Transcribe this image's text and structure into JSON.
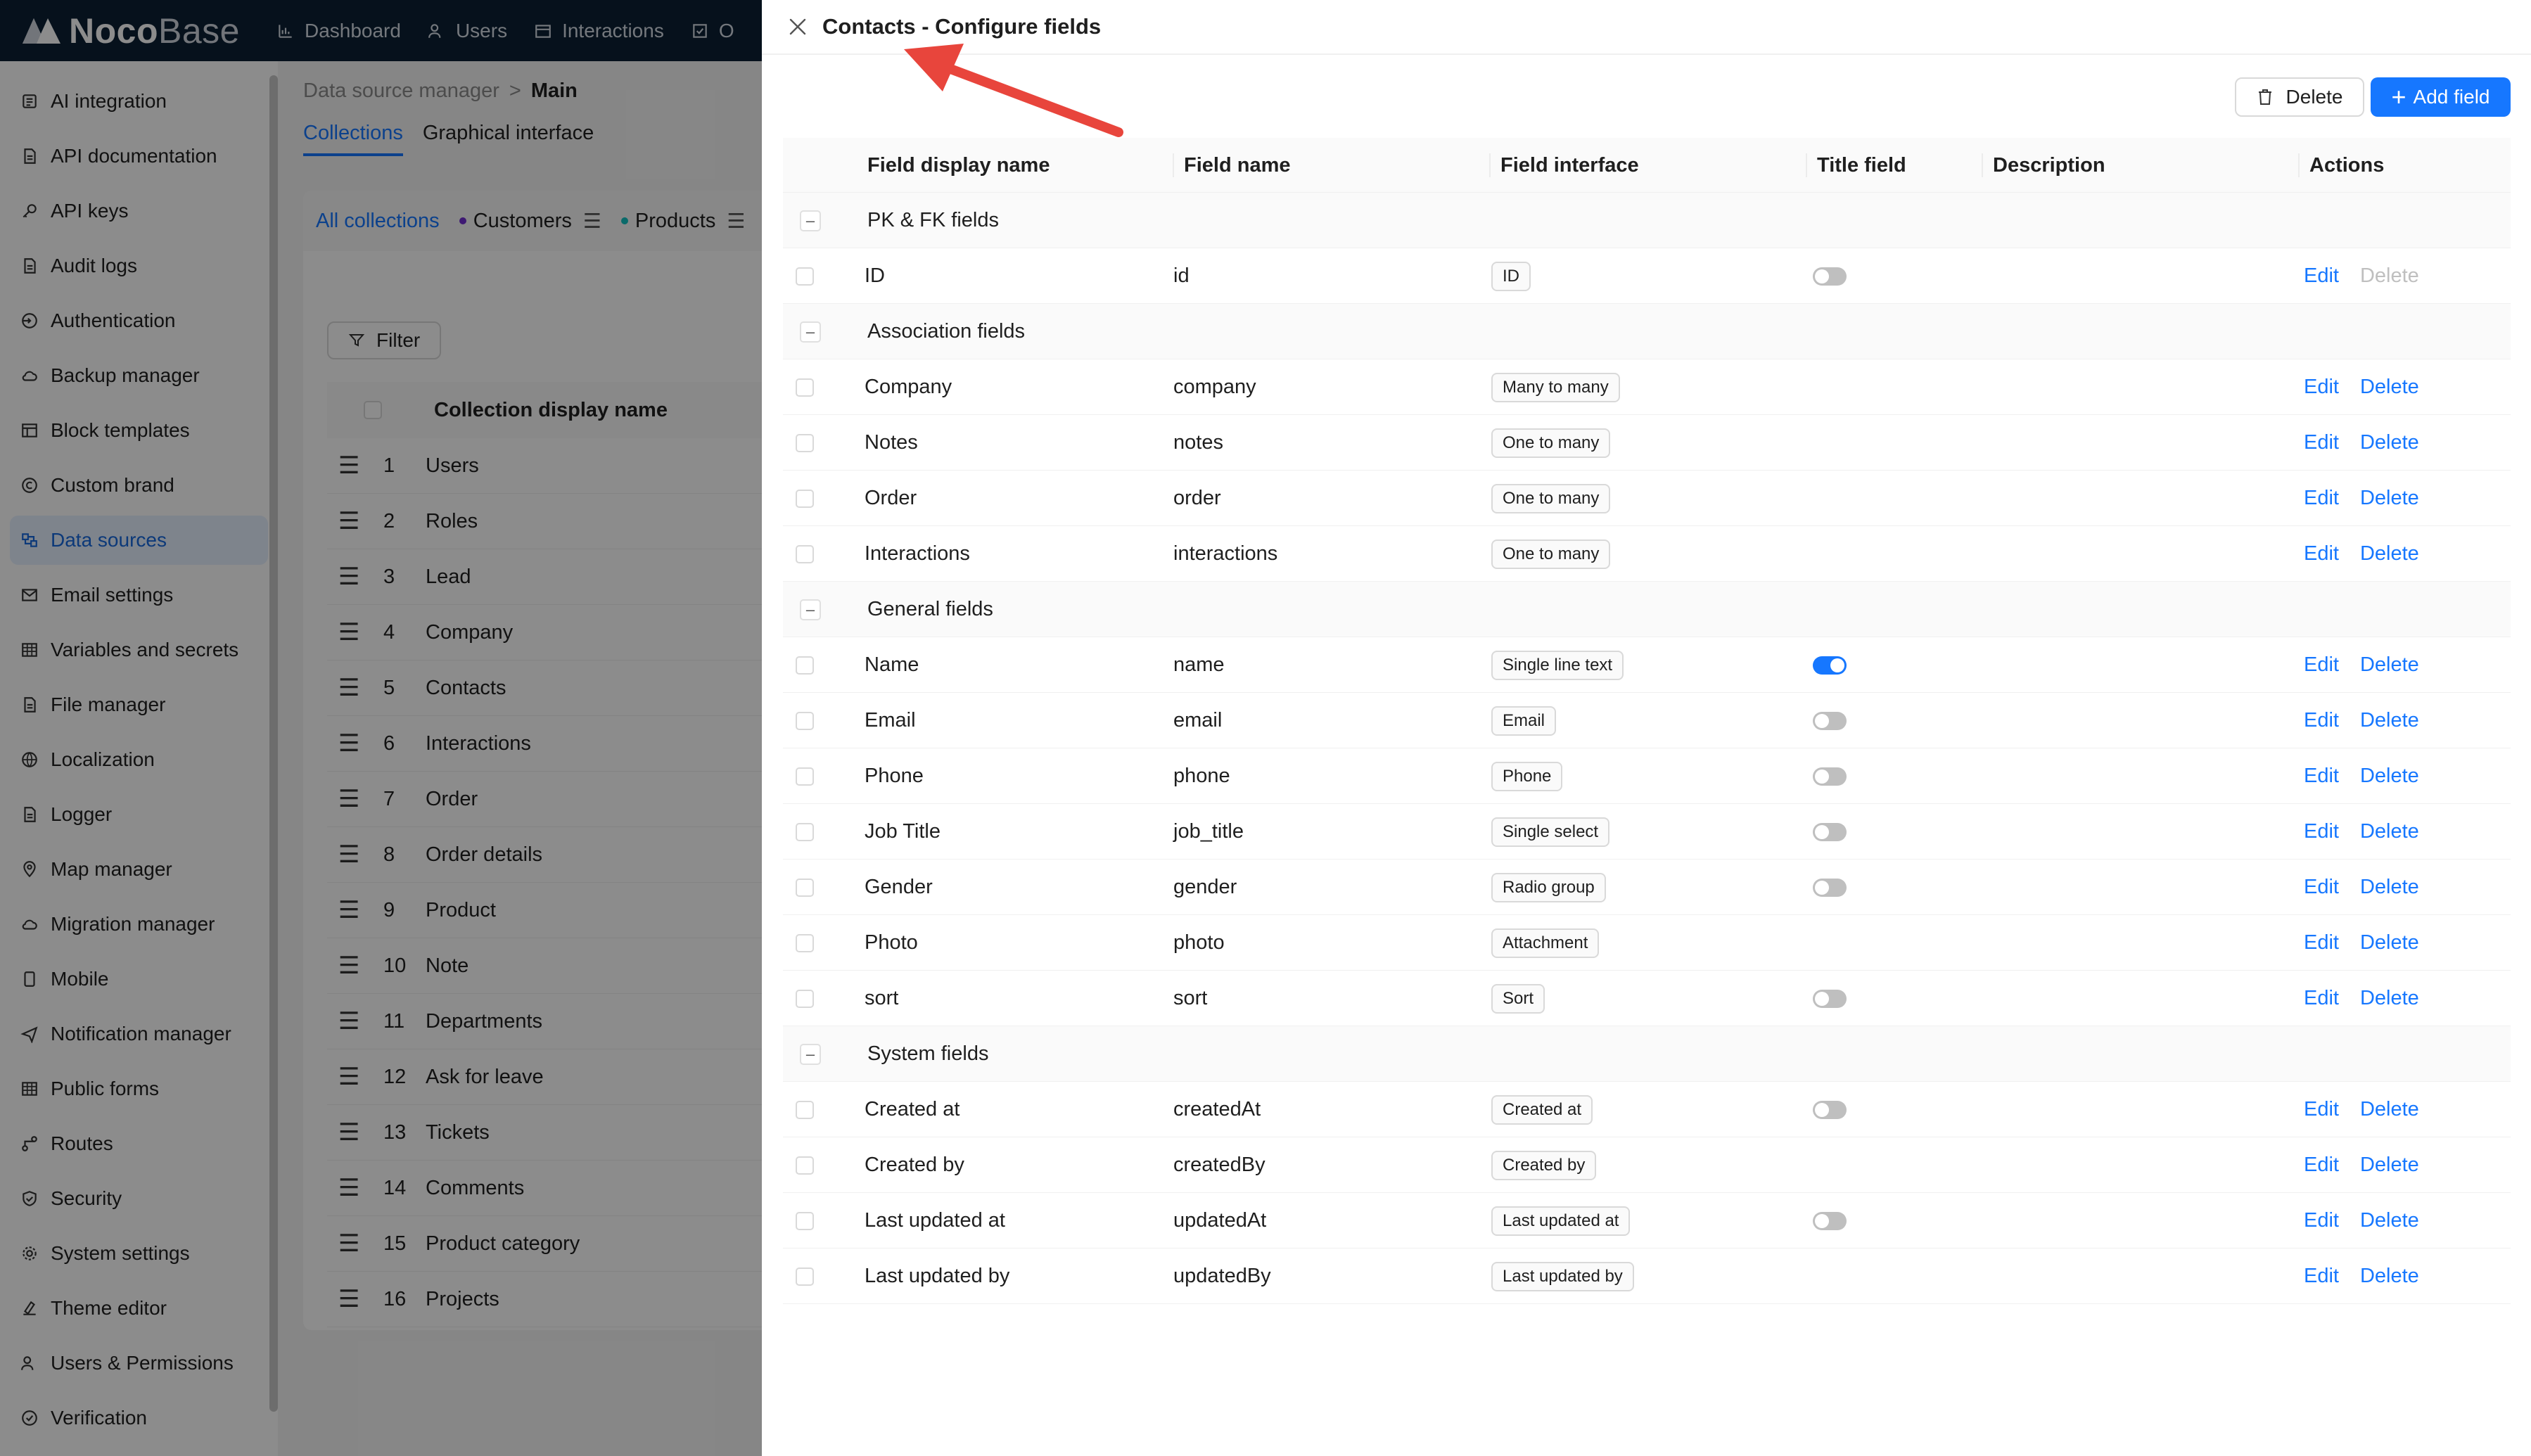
{
  "brand": {
    "name_bold": "Noco",
    "name_light": "Base"
  },
  "topnav": [
    {
      "label": "Dashboard",
      "icon": "chart-icon"
    },
    {
      "label": "Users",
      "icon": "users-icon"
    },
    {
      "label": "Interactions",
      "icon": "calendar-icon"
    },
    {
      "label": "O",
      "icon": "checkbox-icon"
    }
  ],
  "sidebar": {
    "items": [
      {
        "label": "AI integration",
        "icon": "ai-icon",
        "active": false
      },
      {
        "label": "API documentation",
        "icon": "file-icon",
        "active": false
      },
      {
        "label": "API keys",
        "icon": "key-icon",
        "active": false
      },
      {
        "label": "Audit logs",
        "icon": "file-icon",
        "active": false
      },
      {
        "label": "Authentication",
        "icon": "login-icon",
        "active": false
      },
      {
        "label": "Backup manager",
        "icon": "cloud-icon",
        "active": false
      },
      {
        "label": "Block templates",
        "icon": "layout-icon",
        "active": false
      },
      {
        "label": "Custom brand",
        "icon": "copyright-icon",
        "active": false
      },
      {
        "label": "Data sources",
        "icon": "database-icon",
        "active": true
      },
      {
        "label": "Email settings",
        "icon": "mail-icon",
        "active": false
      },
      {
        "label": "Variables and secrets",
        "icon": "table-icon",
        "active": false
      },
      {
        "label": "File manager",
        "icon": "file-icon",
        "active": false
      },
      {
        "label": "Localization",
        "icon": "globe-icon",
        "active": false
      },
      {
        "label": "Logger",
        "icon": "file-icon",
        "active": false
      },
      {
        "label": "Map manager",
        "icon": "pin-icon",
        "active": false
      },
      {
        "label": "Migration manager",
        "icon": "cloud-icon",
        "active": false
      },
      {
        "label": "Mobile",
        "icon": "mobile-icon",
        "active": false
      },
      {
        "label": "Notification manager",
        "icon": "send-icon",
        "active": false
      },
      {
        "label": "Public forms",
        "icon": "table-icon",
        "active": false
      },
      {
        "label": "Routes",
        "icon": "routes-icon",
        "active": false
      },
      {
        "label": "Security",
        "icon": "shield-icon",
        "active": false
      },
      {
        "label": "System settings",
        "icon": "gear-icon",
        "active": false
      },
      {
        "label": "Theme editor",
        "icon": "theme-icon",
        "active": false
      },
      {
        "label": "Users & Permissions",
        "icon": "users-icon",
        "active": false
      },
      {
        "label": "Verification",
        "icon": "check-circle-icon",
        "active": false
      }
    ]
  },
  "main": {
    "breadcrumb": {
      "parent": "Data source manager",
      "separator": ">",
      "current": "Main"
    },
    "tabs": [
      {
        "label": "Collections",
        "active": true
      },
      {
        "label": "Graphical interface",
        "active": false
      }
    ],
    "collection_tabs": [
      {
        "label": "All collections",
        "active": true,
        "dot": ""
      },
      {
        "label": "Customers",
        "active": false,
        "dot": "#722ed1"
      },
      {
        "label": "Products",
        "active": false,
        "dot": "#13c2c2"
      }
    ],
    "filter_label": "Filter",
    "table_header": "Collection display name",
    "collections": [
      {
        "num": "1",
        "name": "Users"
      },
      {
        "num": "2",
        "name": "Roles"
      },
      {
        "num": "3",
        "name": "Lead"
      },
      {
        "num": "4",
        "name": "Company"
      },
      {
        "num": "5",
        "name": "Contacts"
      },
      {
        "num": "6",
        "name": "Interactions"
      },
      {
        "num": "7",
        "name": "Order"
      },
      {
        "num": "8",
        "name": "Order details"
      },
      {
        "num": "9",
        "name": "Product"
      },
      {
        "num": "10",
        "name": "Note"
      },
      {
        "num": "11",
        "name": "Departments"
      },
      {
        "num": "12",
        "name": "Ask for leave"
      },
      {
        "num": "13",
        "name": "Tickets"
      },
      {
        "num": "14",
        "name": "Comments"
      },
      {
        "num": "15",
        "name": "Product category"
      },
      {
        "num": "16",
        "name": "Projects"
      }
    ]
  },
  "drawer": {
    "title": "Contacts - Configure fields",
    "delete_label": "Delete",
    "add_label": "Add field",
    "columns": {
      "display_name": "Field display name",
      "field_name": "Field name",
      "interface": "Field interface",
      "title_field": "Title field",
      "description": "Description",
      "actions": "Actions"
    },
    "groups": [
      {
        "label": "PK & FK fields",
        "expander": "–",
        "rows": [
          {
            "display": "ID",
            "name": "id",
            "interface": "ID",
            "title": "off",
            "delete_disabled": true
          }
        ]
      },
      {
        "label": "Association fields",
        "expander": "–",
        "rows": [
          {
            "display": "Company",
            "name": "company",
            "interface": "Many to many",
            "title": "none",
            "delete_disabled": false
          },
          {
            "display": "Notes",
            "name": "notes",
            "interface": "One to many",
            "title": "none",
            "delete_disabled": false
          },
          {
            "display": "Order",
            "name": "order",
            "interface": "One to many",
            "title": "none",
            "delete_disabled": false
          },
          {
            "display": "Interactions",
            "name": "interactions",
            "interface": "One to many",
            "title": "none",
            "delete_disabled": false
          }
        ]
      },
      {
        "label": "General fields",
        "expander": "–",
        "rows": [
          {
            "display": "Name",
            "name": "name",
            "interface": "Single line text",
            "title": "on",
            "delete_disabled": false
          },
          {
            "display": "Email",
            "name": "email",
            "interface": "Email",
            "title": "off",
            "delete_disabled": false
          },
          {
            "display": "Phone",
            "name": "phone",
            "interface": "Phone",
            "title": "off",
            "delete_disabled": false
          },
          {
            "display": "Job Title",
            "name": "job_title",
            "interface": "Single select",
            "title": "off",
            "delete_disabled": false
          },
          {
            "display": "Gender",
            "name": "gender",
            "interface": "Radio group",
            "title": "off",
            "delete_disabled": false
          },
          {
            "display": "Photo",
            "name": "photo",
            "interface": "Attachment",
            "title": "none",
            "delete_disabled": false
          },
          {
            "display": "sort",
            "name": "sort",
            "interface": "Sort",
            "title": "off",
            "delete_disabled": false
          }
        ]
      },
      {
        "label": "System fields",
        "expander": "–",
        "rows": [
          {
            "display": "Created at",
            "name": "createdAt",
            "interface": "Created at",
            "title": "off",
            "delete_disabled": false
          },
          {
            "display": "Created by",
            "name": "createdBy",
            "interface": "Created by",
            "title": "none",
            "delete_disabled": false
          },
          {
            "display": "Last updated at",
            "name": "updatedAt",
            "interface": "Last updated at",
            "title": "off",
            "delete_disabled": false
          },
          {
            "display": "Last updated by",
            "name": "updatedBy",
            "interface": "Last updated by",
            "title": "none",
            "delete_disabled": false
          }
        ]
      }
    ],
    "edit_label": "Edit",
    "row_delete_label": "Delete"
  },
  "colors": {
    "accent": "#1677ff",
    "topbar": "#0b1f33",
    "annotation_arrow": "#e8453c"
  }
}
